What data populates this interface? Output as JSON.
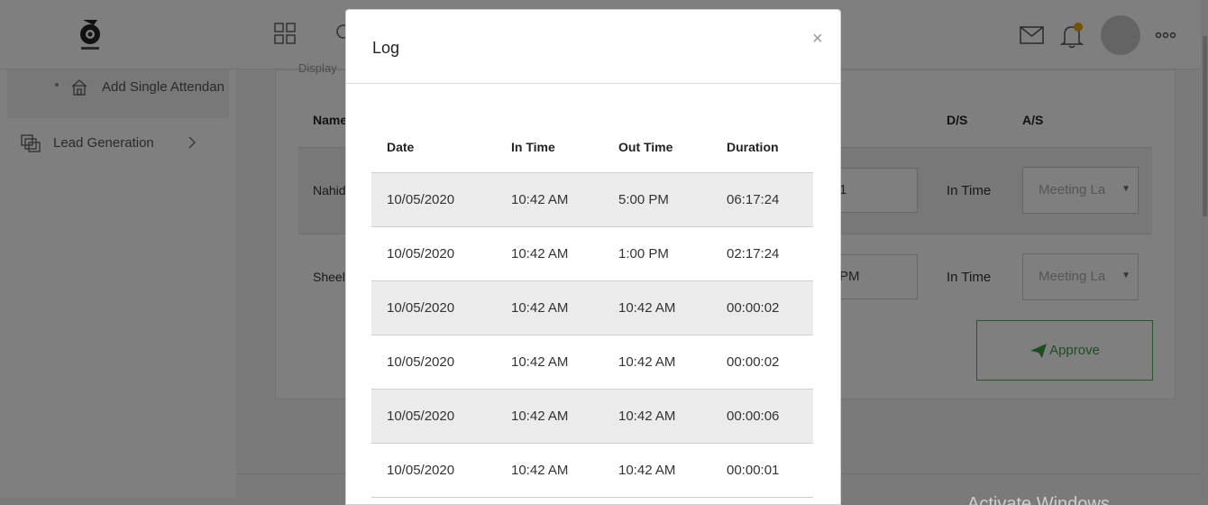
{
  "topbar": {
    "logo_icon": "owl-logo-icon",
    "icons": [
      "grid-icon",
      "search-icon",
      "mail-icon",
      "bell-icon",
      "more-icon"
    ],
    "notification_color": "#e8a317"
  },
  "sidebar": {
    "sub_item_label": "Add Single Attendan",
    "lead_label": "Lead Generation"
  },
  "background": {
    "display_label": "Display",
    "headers": {
      "name": "Name",
      "ds": "D/S",
      "as": "A/S"
    },
    "rows": [
      {
        "name": "Nahid",
        "time": "1",
        "ds": "In Time",
        "select_placeholder": "Meeting La"
      },
      {
        "name": "Sheel",
        "time": "PM",
        "ds": "In Time",
        "select_placeholder": "Meeting La"
      }
    ],
    "approve_label": "Approve",
    "accent_color": "#3a9b3f"
  },
  "modal": {
    "title": "Log",
    "close_symbol": "×",
    "columns": [
      "Date",
      "In Time",
      "Out Time",
      "Duration"
    ],
    "rows": [
      {
        "date": "10/05/2020",
        "in": "10:42 AM",
        "out": "5:00 PM",
        "duration": "06:17:24"
      },
      {
        "date": "10/05/2020",
        "in": "10:42 AM",
        "out": "1:00 PM",
        "duration": "02:17:24"
      },
      {
        "date": "10/05/2020",
        "in": "10:42 AM",
        "out": "10:42 AM",
        "duration": "00:00:02"
      },
      {
        "date": "10/05/2020",
        "in": "10:42 AM",
        "out": "10:42 AM",
        "duration": "00:00:02"
      },
      {
        "date": "10/05/2020",
        "in": "10:42 AM",
        "out": "10:42 AM",
        "duration": "00:00:06"
      },
      {
        "date": "10/05/2020",
        "in": "10:42 AM",
        "out": "10:42 AM",
        "duration": "00:00:01"
      }
    ]
  },
  "watermark": "Activate Windows"
}
